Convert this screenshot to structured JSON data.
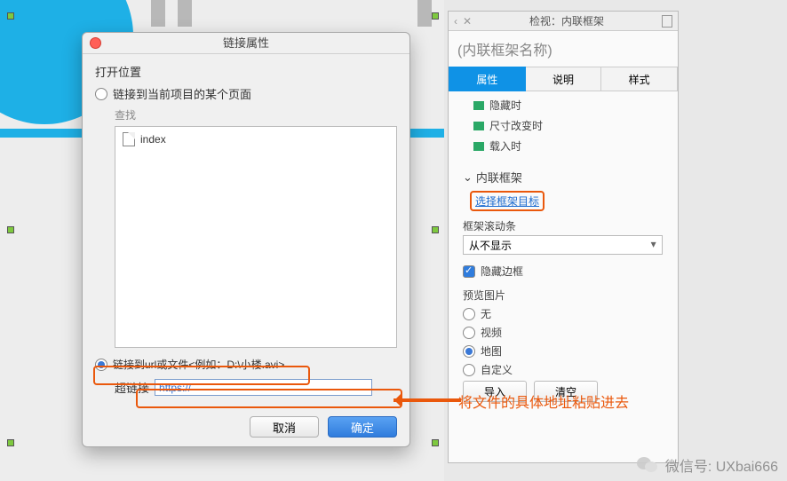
{
  "dialog": {
    "title": "链接属性",
    "open_location_label": "打开位置",
    "option_current": "链接到当前项目的某个页面",
    "search_label": "查找",
    "file_item": "index",
    "option_url": "链接到url或文件<例如：D:\\小楼.avi>",
    "hyperlink_label": "超链接",
    "hyperlink_value": "https://",
    "cancel": "取消",
    "ok": "确定"
  },
  "inspector": {
    "header": "检视：内联框架",
    "subtitle": "(内联框架名称)",
    "tabs": {
      "properties": "属性",
      "description": "说明",
      "style": "样式"
    },
    "events": {
      "hidden": "隐藏时",
      "resize": "尺寸改变时",
      "load": "载入时"
    },
    "group_iframe": "内联框架",
    "select_target": "选择框架目标",
    "scrollbar_label": "框架滚动条",
    "scrollbar_value": "从不显示",
    "hide_border": "隐藏边框",
    "preview_label": "预览图片",
    "preview_options": {
      "none": "无",
      "video": "视频",
      "map": "地图",
      "custom": "自定义"
    },
    "import_btn": "导入",
    "clear_btn": "清空"
  },
  "annotation": "将文件的具体地址粘贴进去",
  "watermark": "微信号: UXbai666"
}
